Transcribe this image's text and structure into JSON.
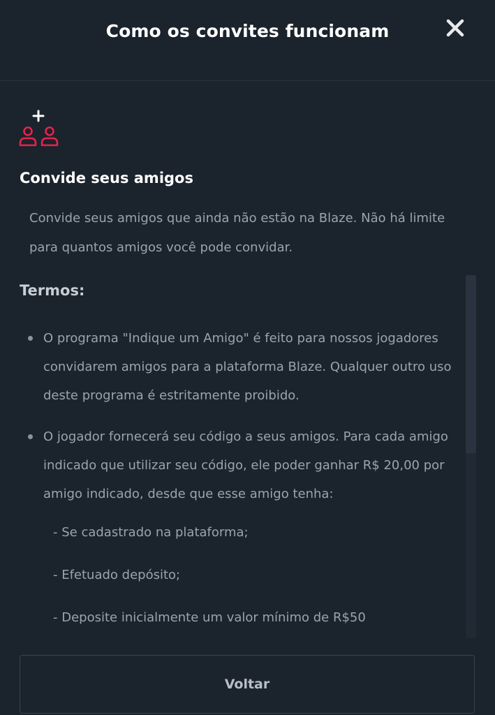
{
  "modal": {
    "title": "Como os convites funcionam",
    "close_icon": "close-icon"
  },
  "invite": {
    "icon": "add-users-icon",
    "accent_color": "#e8234a",
    "title": "Convide seus amigos",
    "text": "Convide seus amigos que ainda não estão na Blaze. Não há limite para quantos amigos você pode convidar."
  },
  "terms": {
    "title": "Termos:",
    "items": [
      {
        "text": "O programa \"Indique um Amigo\" é feito para nossos jogadores convidarem amigos para a plataforma Blaze. Qualquer outro uso deste programa é estritamente proibido."
      },
      {
        "text": "O jogador fornecerá seu código a seus amigos. Para cada amigo indicado que utilizar seu código, ele poder ganhar R$ 20,00 por amigo indicado, desde que esse amigo tenha:",
        "conditions": [
          "- Se cadastrado na plataforma;",
          "- Efetuado depósito;",
          "- Deposite inicialmente um valor mínimo de R$50"
        ]
      }
    ]
  },
  "footer": {
    "back_label": "Voltar"
  }
}
